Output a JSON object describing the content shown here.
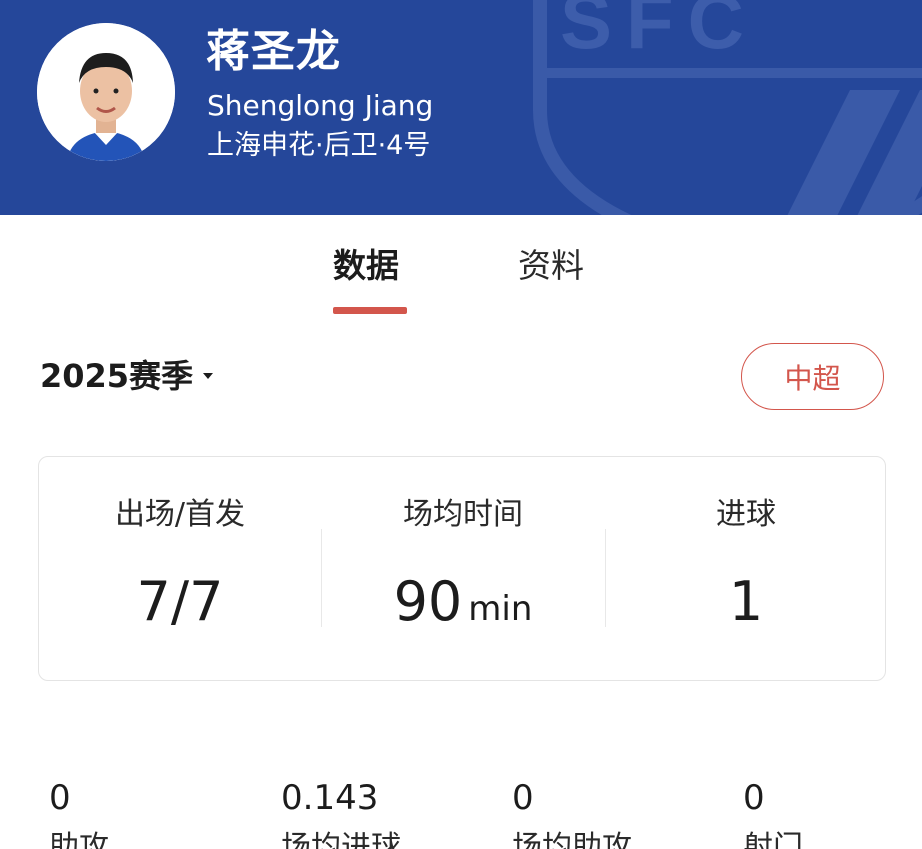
{
  "player": {
    "name_cn": "蒋圣龙",
    "name_en": "Shenglong Jiang",
    "team_info": "上海申花·后卫·4号",
    "crest_text": "SFC"
  },
  "tabs": [
    {
      "label": "数据",
      "active": true
    },
    {
      "label": "资料",
      "active": false
    }
  ],
  "season": {
    "label": "2025赛季"
  },
  "league": {
    "label": "中超"
  },
  "summary": [
    {
      "label": "出场/首发",
      "value": "7/7",
      "unit": ""
    },
    {
      "label": "场均时间",
      "value": "90",
      "unit": "min"
    },
    {
      "label": "进球",
      "value": "1",
      "unit": ""
    }
  ],
  "details": [
    {
      "value": "0",
      "label": "助攻"
    },
    {
      "value": "0.143",
      "label": "场均进球"
    },
    {
      "value": "0",
      "label": "场均助攻"
    },
    {
      "value": "0",
      "label": "射门"
    }
  ],
  "colors": {
    "header_bg": "#25479a",
    "accent": "#d3564c"
  }
}
